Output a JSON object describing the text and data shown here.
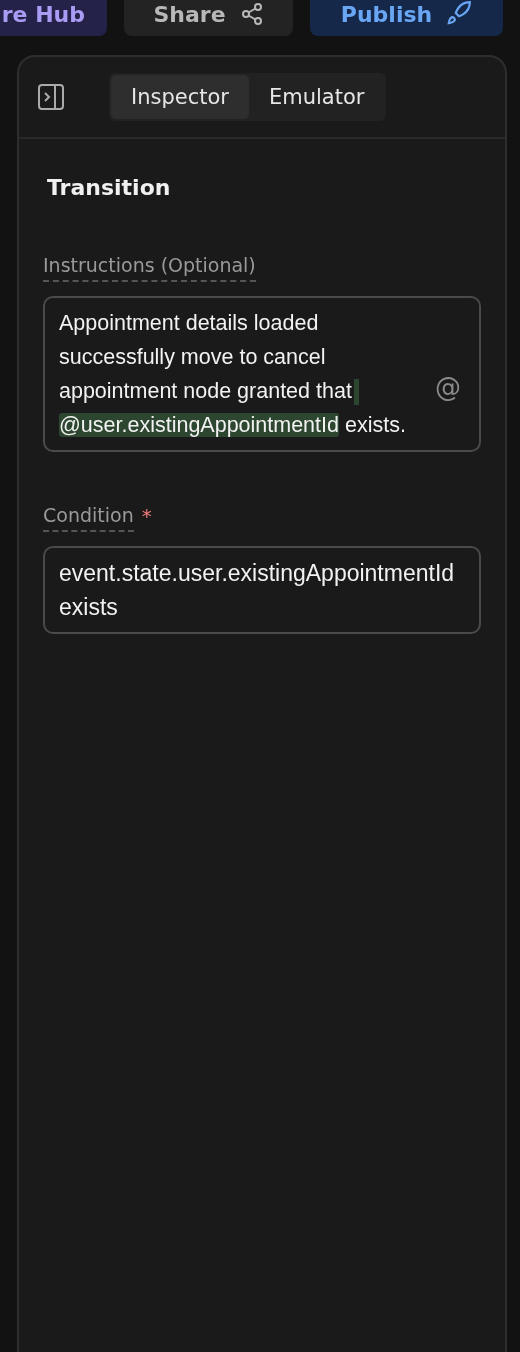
{
  "top_bar": {
    "buttons": [
      {
        "label": "re Hub",
        "kind": "hub"
      },
      {
        "label": "Share",
        "kind": "share"
      },
      {
        "label": "Publish",
        "kind": "publish"
      }
    ]
  },
  "panel": {
    "tabs": [
      {
        "label": "Inspector",
        "selected": true
      },
      {
        "label": "Emulator",
        "selected": false
      }
    ],
    "title": "Transition",
    "instructions": {
      "label": "Instructions (Optional)",
      "mention_button": "@",
      "segments": [
        {
          "kind": "plain",
          "text": "Appointment details loaded successfully move to cancel appointment node granted that"
        },
        {
          "kind": "mention",
          "text": "@user.existingAppointmentId"
        },
        {
          "kind": "plain",
          "text": "exists."
        }
      ]
    },
    "condition": {
      "label": "Condition",
      "required": true,
      "required_mark": "*",
      "value": "event.state.user.existingAppointmentId exists"
    }
  }
}
